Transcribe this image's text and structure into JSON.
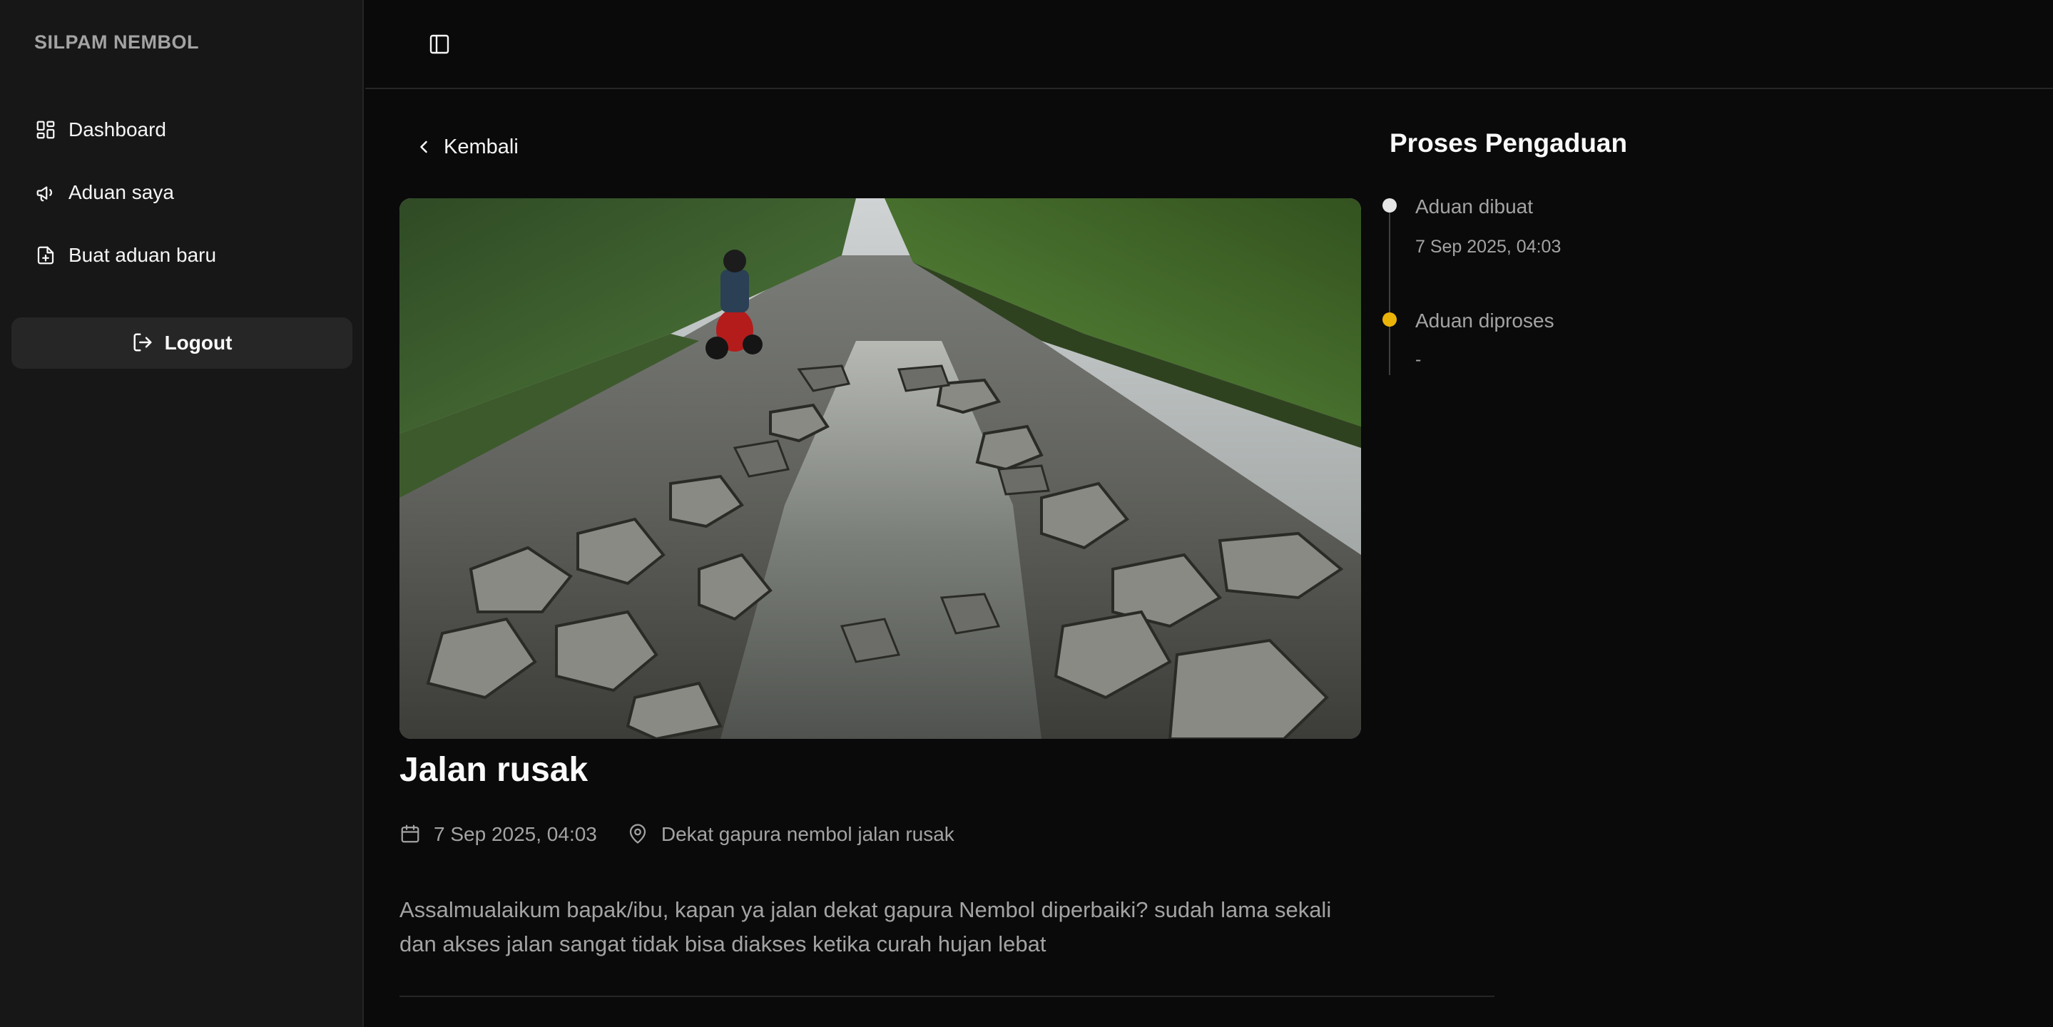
{
  "app": {
    "brand": "SILPAM NEMBOL"
  },
  "sidebar": {
    "items": [
      {
        "label": "Dashboard",
        "icon": "dashboard-icon"
      },
      {
        "label": "Aduan saya",
        "icon": "megaphone-icon"
      },
      {
        "label": "Buat aduan baru",
        "icon": "file-plus-icon"
      }
    ],
    "logout_label": "Logout"
  },
  "header": {
    "toggle_icon": "sidebar-toggle-icon"
  },
  "complaint": {
    "back_label": "Kembali",
    "title": "Jalan rusak",
    "date": "7 Sep 2025, 04:03",
    "location": "Dekat gapura nembol jalan rusak",
    "description": "Assalmualaikum bapak/ibu, kapan ya jalan dekat gapura Nembol diperbaiki? sudah lama sekali dan akses jalan sangat tidak bisa diakses ketika curah hujan lebat"
  },
  "process": {
    "title": "Proses Pengaduan",
    "steps": [
      {
        "label": "Aduan dibuat",
        "time": "7 Sep 2025, 04:03",
        "color": "#e5e5e5"
      },
      {
        "label": "Aduan diproses",
        "time": "-",
        "color": "#eab308"
      }
    ]
  }
}
